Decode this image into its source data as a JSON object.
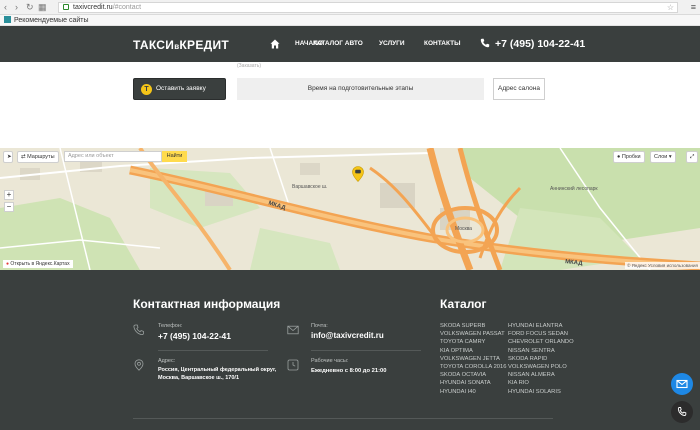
{
  "browser": {
    "url_host": "taxivcredit.ru",
    "url_path": "/#contact",
    "bookmark": "Рекомендуемые сайты"
  },
  "header": {
    "logo_main": "ТАКСИ",
    "logo_small": "в",
    "logo_tail": "КРЕДИТ",
    "nav": [
      "НАЧАЛО",
      "КАТАЛОГ АВТО",
      "УСЛУГИ",
      "КОНТАКТЫ"
    ],
    "phone": "+7 (495) 104-22-41"
  },
  "content": {
    "faint_text": "(Заказать)",
    "order_button": "Оставить заявку",
    "order_icon": "Т",
    "tab_status": "Время на подготовительные этапы",
    "address_button": "Адрес салона"
  },
  "map": {
    "routes_button": "Маршруты",
    "search_placeholder": "Адрес или объект",
    "find_button": "Найти",
    "traffic_button": "Пробки",
    "layers_button": "Слои",
    "open_link": "Открыть в Яндекс.Картах",
    "copyright": "© Яндекс Условия использования",
    "labels": [
      "МКАД",
      "МКАД",
      "Москва",
      "Аннинский лесопарк",
      "Варшавское ш."
    ]
  },
  "footer": {
    "contact_title": "Контактная информация",
    "catalog_title": "Каталог",
    "phone_label": "Телефон:",
    "phone_value": "+7 (495) 104-22-41",
    "mail_label": "Почта:",
    "mail_value": "info@taxivcredit.ru",
    "address_label": "Адрес:",
    "address_line1": "Россия, Центральный федеральный округ,",
    "address_line2": "Москва, Варшавское ш., 170/1",
    "hours_label": "Рабочие часы:",
    "hours_value": "Ежедневно с 8:00 до 21:00",
    "catalog_col1": [
      "SKODA SUPERB",
      "VOLKSWAGEN PASSAT",
      "TOYOTA CAMRY",
      "KIA OPTIMA",
      "VOLKSWAGEN JETTA",
      "TOYOTA COROLLA 2016",
      "SKODA OCTAVIA",
      "HYUNDAI SONATA",
      "HYUNDAI I40"
    ],
    "catalog_col2": [
      "HYUNDAI ELANTRA",
      "FORD FOCUS SEDAN",
      "CHEVROLET ORLANDO",
      "NISSAN SENTRA",
      "SKODA RAPID",
      "VOLKSWAGEN POLO",
      "NISSAN ALMERA",
      "KIA RIO",
      "HYUNDAI SOLARIS"
    ]
  },
  "colors": {
    "dark": "#3a3f3e",
    "accent_yellow": "#f5c518",
    "fab_blue": "#1e88e5"
  }
}
